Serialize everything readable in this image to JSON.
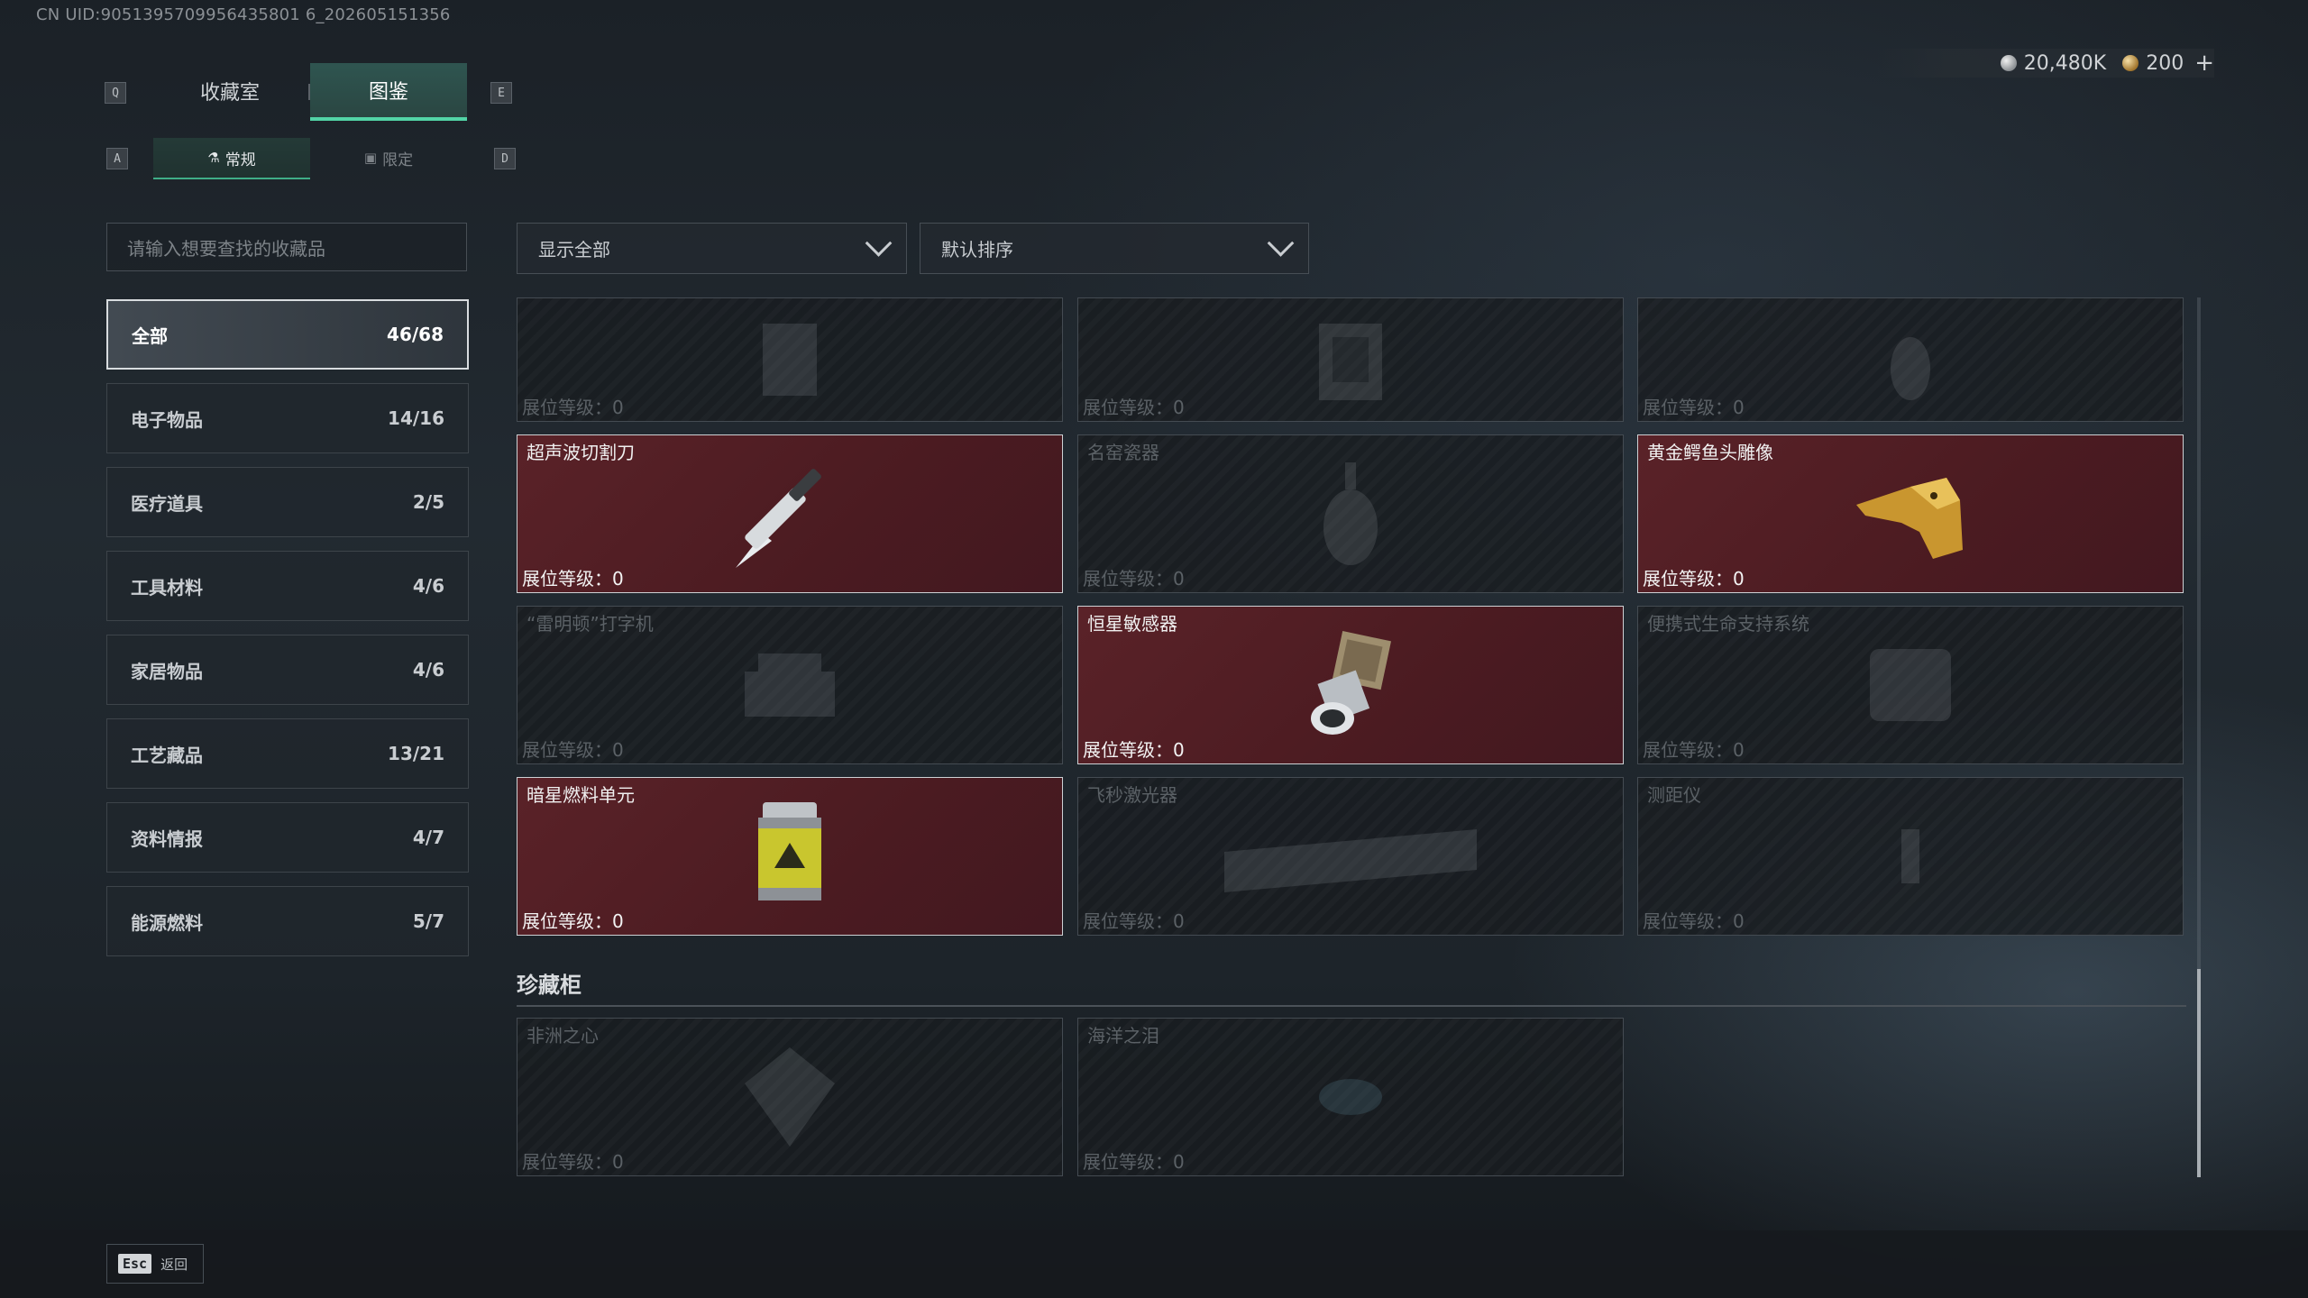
{
  "uid": "CN UID:9051395709956435801 6_202605151356",
  "currency": {
    "silver": "20,480K",
    "gold": "200",
    "add": "+"
  },
  "keys": {
    "prev_tab": "Q",
    "next_tab": "E",
    "prev_sub": "A",
    "next_sub": "D"
  },
  "tabs": [
    {
      "label": "收藏室"
    },
    {
      "label": "图鉴"
    }
  ],
  "subtabs": [
    {
      "label": "常规",
      "icon": "flask-icon"
    },
    {
      "label": "限定",
      "icon": "image-icon"
    }
  ],
  "search": {
    "placeholder": "请输入想要查找的收藏品"
  },
  "categories": [
    {
      "label": "全部",
      "count": "46/68"
    },
    {
      "label": "电子物品",
      "count": "14/16"
    },
    {
      "label": "医疗道具",
      "count": "2/5"
    },
    {
      "label": "工具材料",
      "count": "4/6"
    },
    {
      "label": "家居物品",
      "count": "4/6"
    },
    {
      "label": "工艺藏品",
      "count": "13/21"
    },
    {
      "label": "资料情报",
      "count": "4/7"
    },
    {
      "label": "能源燃料",
      "count": "5/7"
    }
  ],
  "filters": {
    "show": "显示全部",
    "sort": "默认排序"
  },
  "level_label": "展位等级：",
  "cards": [
    {
      "name": "",
      "level": "0",
      "owned": false,
      "icon": "artifact-icon"
    },
    {
      "name": "",
      "level": "0",
      "owned": false,
      "icon": "artifact-icon"
    },
    {
      "name": "",
      "level": "0",
      "owned": false,
      "icon": "artifact-icon"
    },
    {
      "name": "超声波切割刀",
      "level": "0",
      "owned": true,
      "icon": "ultrasonic-knife-icon"
    },
    {
      "name": "名窑瓷器",
      "level": "0",
      "owned": false,
      "icon": "porcelain-vase-icon"
    },
    {
      "name": "黄金鳄鱼头雕像",
      "level": "0",
      "owned": true,
      "icon": "gold-crocodile-head-icon"
    },
    {
      "name": "“雷明顿”打字机",
      "level": "0",
      "owned": false,
      "icon": "typewriter-icon"
    },
    {
      "name": "恒星敏感器",
      "level": "0",
      "owned": true,
      "icon": "star-sensor-icon"
    },
    {
      "name": "便携式生命支持系统",
      "level": "0",
      "owned": false,
      "icon": "life-support-icon"
    },
    {
      "name": "暗星燃料单元",
      "level": "0",
      "owned": true,
      "icon": "fuel-cell-icon"
    },
    {
      "name": "飞秒激光器",
      "level": "0",
      "owned": false,
      "icon": "laser-icon"
    },
    {
      "name": "测距仪",
      "level": "0",
      "owned": false,
      "icon": "rangefinder-icon"
    }
  ],
  "section": {
    "title": "珍藏柜"
  },
  "treasures": [
    {
      "name": "非洲之心",
      "level": "0",
      "owned": false,
      "icon": "diamond-icon"
    },
    {
      "name": "海洋之泪",
      "level": "0",
      "owned": false,
      "icon": "gem-icon"
    }
  ],
  "footer": {
    "key": "Esc",
    "label": "返回"
  }
}
